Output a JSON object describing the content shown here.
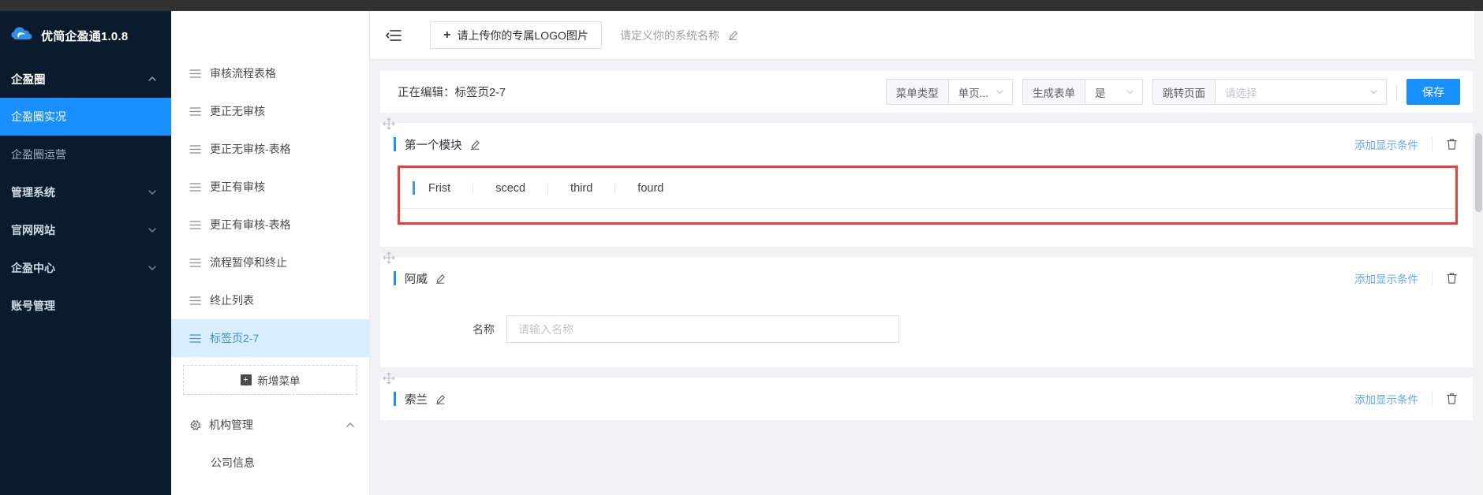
{
  "brand": {
    "title": "优简企盈通1.0.8",
    "logo_icon": "cloud-logo-icon"
  },
  "left_nav": {
    "items": [
      {
        "label": "企盈圈",
        "type": "group",
        "expanded": true,
        "icon": "chevron-up-icon",
        "active": false
      },
      {
        "label": "企盈圈实况",
        "type": "item",
        "expanded": false,
        "icon": "",
        "active": true
      },
      {
        "label": "企盈圈运营",
        "type": "item",
        "expanded": false,
        "icon": "",
        "active": false
      },
      {
        "label": "管理系统",
        "type": "group",
        "expanded": false,
        "icon": "chevron-down-icon",
        "active": false
      },
      {
        "label": "官网网站",
        "type": "group",
        "expanded": false,
        "icon": "chevron-down-icon",
        "active": false
      },
      {
        "label": "企盈中心",
        "type": "group",
        "expanded": false,
        "icon": "chevron-down-icon",
        "active": false
      },
      {
        "label": "账号管理",
        "type": "group",
        "expanded": false,
        "icon": "",
        "active": false
      }
    ]
  },
  "menu_tree": {
    "items": [
      {
        "label": "审核流程表格",
        "icon": "menu-lines-icon",
        "selected": false
      },
      {
        "label": "更正无审核",
        "icon": "menu-lines-icon",
        "selected": false
      },
      {
        "label": "更正无审核-表格",
        "icon": "menu-lines-icon",
        "selected": false
      },
      {
        "label": "更正有审核",
        "icon": "menu-lines-icon",
        "selected": false
      },
      {
        "label": "更正有审核-表格",
        "icon": "menu-lines-icon",
        "selected": false
      },
      {
        "label": "流程暂停和终止",
        "icon": "menu-lines-icon",
        "selected": false
      },
      {
        "label": "终止列表",
        "icon": "menu-lines-icon",
        "selected": false
      },
      {
        "label": "标签页2-7",
        "icon": "menu-lines-icon",
        "selected": true
      }
    ],
    "add_menu_label": "新增菜单",
    "add_menu_icon": "plus-square-icon",
    "org_group": {
      "label": "机构管理",
      "icon": "gear-icon",
      "expand_icon": "chevron-up-icon",
      "children": [
        {
          "label": "公司信息"
        }
      ]
    }
  },
  "header": {
    "collapse_icon": "menu-fold-icon",
    "logo_upload_label": "请上传你的专属LOGO图片",
    "logo_upload_icon": "plus-icon",
    "system_name_placeholder": "请定义你的系统名称",
    "system_name_edit_icon": "pencil-icon"
  },
  "toolbar": {
    "editing_label": "正在编辑：标签页2-7",
    "menu_type_label": "菜单类型",
    "menu_type_value": "单页...",
    "gen_form_label": "生成表单",
    "gen_form_value": "是",
    "jump_page_label": "跳转页面",
    "jump_page_placeholder": "请选择",
    "save_label": "保存",
    "chevron_icon": "chevron-down-icon",
    "accent_color": "#1890ff"
  },
  "modules": [
    {
      "title": "第一个模块",
      "edit_icon": "pencil-icon",
      "add_condition_label": "添加显示条件",
      "delete_icon": "trash-icon",
      "drag_icon": "drag-move-icon",
      "highlighted": true,
      "tabs": [
        {
          "label": "Frist",
          "active": true
        },
        {
          "label": "scecd",
          "active": false
        },
        {
          "label": "third",
          "active": false
        },
        {
          "label": "fourd",
          "active": false
        }
      ]
    },
    {
      "title": "阿威",
      "edit_icon": "pencil-icon",
      "add_condition_label": "添加显示条件",
      "delete_icon": "trash-icon",
      "drag_icon": "drag-move-icon",
      "highlighted": false,
      "fields": [
        {
          "label": "名称",
          "placeholder": "请输入名称",
          "value": ""
        }
      ]
    },
    {
      "title": "索兰",
      "edit_icon": "pencil-icon",
      "add_condition_label": "添加显示条件",
      "delete_icon": "trash-icon",
      "drag_icon": "drag-move-icon",
      "highlighted": false
    }
  ],
  "colors": {
    "sidebar_bg": "#0b1b2e",
    "sidebar_active": "#1890ff",
    "tree_selected_bg": "#d9eeff",
    "tree_selected_text": "#3f8ddb",
    "primary": "#1890ff",
    "highlight_border": "#e8403a",
    "canvas": "#f0f2f5"
  }
}
